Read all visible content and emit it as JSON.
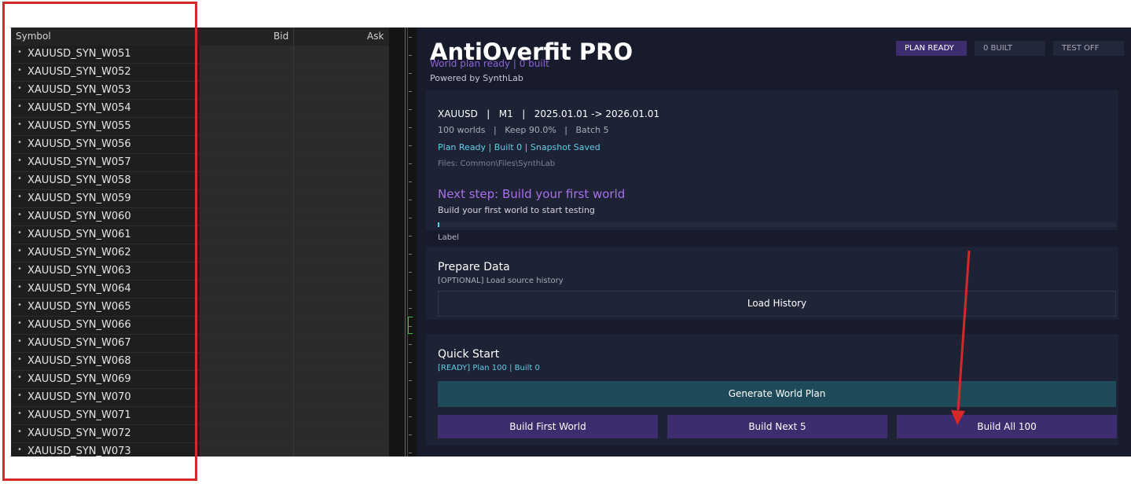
{
  "market_watch": {
    "headers": {
      "symbol": "Symbol",
      "bid": "Bid",
      "ask": "Ask"
    },
    "symbols": [
      "XAUUSD_SYN_W051",
      "XAUUSD_SYN_W052",
      "XAUUSD_SYN_W053",
      "XAUUSD_SYN_W054",
      "XAUUSD_SYN_W055",
      "XAUUSD_SYN_W056",
      "XAUUSD_SYN_W057",
      "XAUUSD_SYN_W058",
      "XAUUSD_SYN_W059",
      "XAUUSD_SYN_W060",
      "XAUUSD_SYN_W061",
      "XAUUSD_SYN_W062",
      "XAUUSD_SYN_W063",
      "XAUUSD_SYN_W064",
      "XAUUSD_SYN_W065",
      "XAUUSD_SYN_W066",
      "XAUUSD_SYN_W067",
      "XAUUSD_SYN_W068",
      "XAUUSD_SYN_W069",
      "XAUUSD_SYN_W070",
      "XAUUSD_SYN_W071",
      "XAUUSD_SYN_W072",
      "XAUUSD_SYN_W073"
    ],
    "bullet": "•"
  },
  "panel": {
    "title": "AntiOverfit PRO",
    "status_line": "World plan ready | 0 built",
    "powered_by": "Powered by SynthLab",
    "badges": {
      "plan": "PLAN READY",
      "built": "0 BUILT",
      "test": "TEST OFF"
    },
    "summary": {
      "line1": "XAUUSD   |   M1   |   2025.01.01 -> 2026.01.01",
      "line2": "100 worlds   |   Keep 90.0%   |   Batch 5",
      "line3": "Plan Ready | Built 0 | Snapshot Saved",
      "line4": "Files: Common\\Files\\SynthLab",
      "next_step": "Next step: Build your first world",
      "next_step_sub": "Build your first world to start testing",
      "progress": 0.0
    },
    "label_text": "Label",
    "prepare": {
      "title": "Prepare Data",
      "subtitle": "[OPTIONAL] Load source history",
      "load_button": "Load History"
    },
    "quick_start": {
      "title": "Quick Start",
      "subtitle": "[READY] Plan 100 | Built 0",
      "generate_button": "Generate World Plan",
      "build_first": "Build First World",
      "build_next": "Build Next 5",
      "build_all": "Build All 100"
    }
  },
  "colors": {
    "highlight_red": "#d62828",
    "accent_purple": "#3d2c6e",
    "accent_cyan": "#5fd0e8",
    "panel_bg": "#181b2c"
  }
}
